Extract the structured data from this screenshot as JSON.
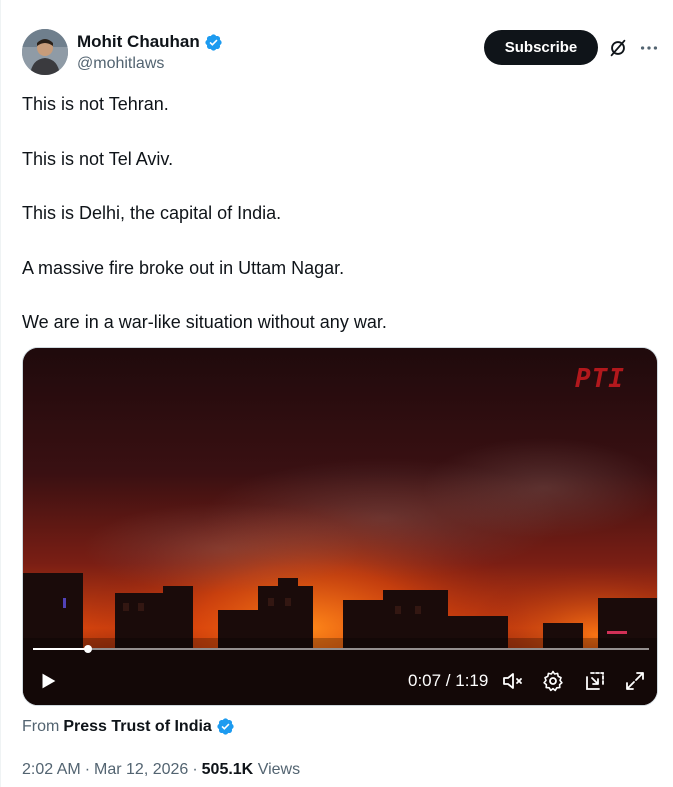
{
  "author": {
    "name": "Mohit Chauhan",
    "handle": "@mohitlaws",
    "verified": true
  },
  "actions": {
    "subscribe_label": "Subscribe",
    "grok_icon": "grok-slash-icon",
    "more_icon": "ellipsis-icon"
  },
  "tweet": {
    "lines": [
      "This is not Tehran.",
      "This is not Tel Aviv.",
      "This is Delhi, the capital of India.",
      "A massive fire broke out in Uttam Nagar.",
      "We are in a war-like situation without any war."
    ]
  },
  "video": {
    "watermark": "PTI",
    "current_time": "0:07",
    "duration": "1:19",
    "time_display": "0:07 / 1:19",
    "progress_fraction": 0.089,
    "muted": true
  },
  "source": {
    "prefix": "From",
    "name": "Press Trust of India",
    "verified": true
  },
  "meta": {
    "time": "2:02 AM",
    "date": "Mar 12, 2026",
    "views_count": "505.1K",
    "views_label": "Views"
  },
  "colors": {
    "verified_blue": "#1d9bf0",
    "text_primary": "#0f1419",
    "text_secondary": "#536471",
    "fire_orange": "#ff6a00",
    "pti_red": "#c21a1f"
  }
}
